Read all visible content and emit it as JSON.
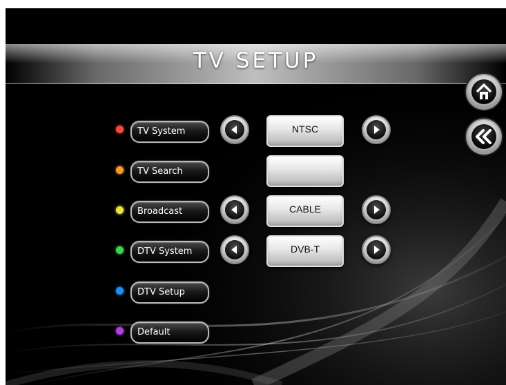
{
  "header": {
    "title": "TV SETUP"
  },
  "nav": {
    "home": "home-icon",
    "back": "back-icon"
  },
  "menu": {
    "items": [
      {
        "label": "TV System",
        "dot_color": "#f04a3a",
        "value": "NTSC",
        "has_arrows": true
      },
      {
        "label": "TV Search",
        "dot_color": "#f59a2b",
        "value": "",
        "has_arrows": false
      },
      {
        "label": "Broadcast",
        "dot_color": "#f0e040",
        "value": "CABLE",
        "has_arrows": true
      },
      {
        "label": "DTV System",
        "dot_color": "#3fcf5a",
        "value": "DVB-T",
        "has_arrows": true
      },
      {
        "label": "DTV Setup",
        "dot_color": "#1e8ff0",
        "value": null,
        "has_arrows": false
      },
      {
        "label": "Default",
        "dot_color": "#b040e0",
        "value": null,
        "has_arrows": false
      }
    ]
  },
  "colors": {
    "background": "#000000",
    "frame": "#ffffff",
    "button_border": "#b9b9b9"
  }
}
